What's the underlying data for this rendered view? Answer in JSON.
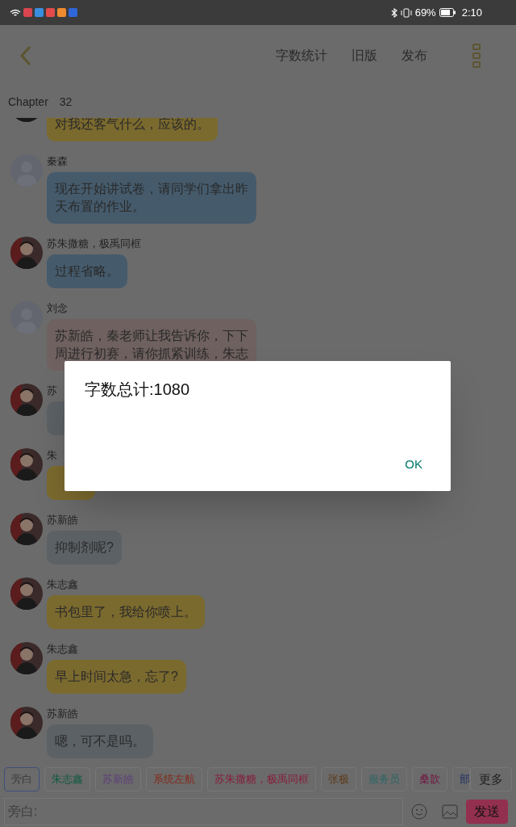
{
  "status_bar": {
    "battery": "69%",
    "time": "2:10"
  },
  "header": {
    "actions": [
      "字数统计",
      "旧版",
      "发布"
    ]
  },
  "chapter": {
    "label": "Chapter",
    "number": "32"
  },
  "messages": [
    {
      "text": "对我还客气什么，应该的。",
      "color": "#7b6a2e"
    },
    {
      "kind": "default",
      "name": "秦森",
      "text": "现在开始讲试卷，请同学们拿出昨天布置的作业。",
      "color": "#455b6c"
    },
    {
      "name": "苏朱撒糖，极禹同框",
      "text": "过程省略。",
      "color": "#455b6c"
    },
    {
      "kind": "default",
      "name": "刘念",
      "text": "苏新皓，秦老师让我告诉你，下下周进行初赛，请你抓紧训练，朱志",
      "color": "#6f6160"
    },
    {
      "name": "苏",
      "color": "#5c6165"
    },
    {
      "name": "朱",
      "color": "#7b6a2e"
    },
    {
      "name": "苏新皓",
      "text": "抑制剂呢?",
      "color": "#5c6165"
    },
    {
      "name": "朱志鑫",
      "text": "书包里了，我给你喷上。",
      "color": "#7b6a2e"
    },
    {
      "name": "朱志鑫",
      "text": "早上时间太急，忘了?",
      "color": "#7b6a2e"
    },
    {
      "name": "苏新皓",
      "text": "嗯，可不是吗。",
      "color": "#5c6165"
    }
  ],
  "dialog": {
    "message": "字数总计:1080",
    "button": "OK"
  },
  "roles": [
    {
      "label": "旁白",
      "selected": true,
      "color": "#3a3a3a"
    },
    {
      "label": "朱志鑫",
      "selected": false,
      "color": "#0e5a40"
    },
    {
      "label": "苏新皓",
      "selected": false,
      "color": "#5e3d7a"
    },
    {
      "label": "系统左航",
      "selected": false,
      "color": "#842818"
    },
    {
      "label": "苏朱撒糖，极禹同框",
      "selected": false,
      "color": "#861c3a"
    },
    {
      "label": "张极",
      "selected": false,
      "color": "#5e3a18"
    },
    {
      "label": "服务员",
      "selected": false,
      "color": "#2e6666"
    },
    {
      "label": "桑歆",
      "selected": false,
      "color": "#701440"
    },
    {
      "label": "部",
      "selected": false,
      "color": "#1c2c60"
    }
  ],
  "more_button": "更多",
  "composer": {
    "placeholder": "旁白:",
    "send": "发送"
  }
}
